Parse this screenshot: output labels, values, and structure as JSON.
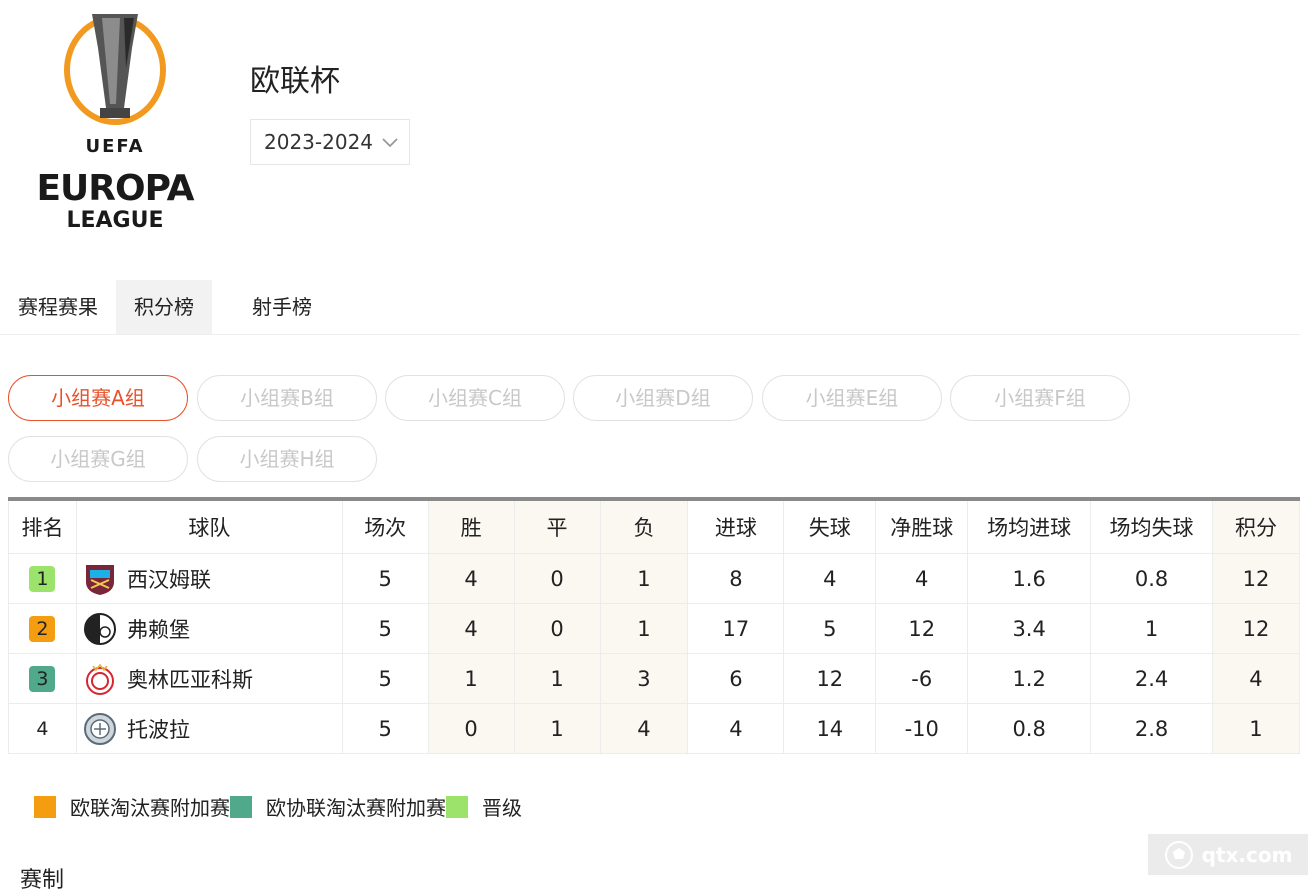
{
  "competition": {
    "title": "欧联杯",
    "season": "2023-2024",
    "logo_text": {
      "uefa": "UEFA",
      "line1": "EUROPA",
      "line2": "LEAGUE"
    }
  },
  "tabs": [
    {
      "label": "赛程赛果",
      "active": false
    },
    {
      "label": "积分榜",
      "active": true
    },
    {
      "label": "射手榜",
      "active": false
    }
  ],
  "groups": [
    {
      "label": "小组赛A组",
      "active": true
    },
    {
      "label": "小组赛B组",
      "active": false
    },
    {
      "label": "小组赛C组",
      "active": false
    },
    {
      "label": "小组赛D组",
      "active": false
    },
    {
      "label": "小组赛E组",
      "active": false
    },
    {
      "label": "小组赛F组",
      "active": false
    },
    {
      "label": "小组赛G组",
      "active": false
    },
    {
      "label": "小组赛H组",
      "active": false
    }
  ],
  "table": {
    "headers": [
      "排名",
      "球队",
      "场次",
      "胜",
      "平",
      "负",
      "进球",
      "失球",
      "净胜球",
      "场均进球",
      "场均失球",
      "积分"
    ],
    "rows": [
      {
        "rank": "1",
        "badge_color": "#9be36a",
        "team": "西汉姆联",
        "crest": "west-ham-crest",
        "played": "5",
        "won": "4",
        "draw": "0",
        "lost": "1",
        "gf": "8",
        "ga": "4",
        "gd": "4",
        "avg_gf": "1.6",
        "avg_ga": "0.8",
        "points": "12"
      },
      {
        "rank": "2",
        "badge_color": "#f59d10",
        "team": "弗赖堡",
        "crest": "freiburg-crest",
        "played": "5",
        "won": "4",
        "draw": "0",
        "lost": "1",
        "gf": "17",
        "ga": "5",
        "gd": "12",
        "avg_gf": "3.4",
        "avg_ga": "1",
        "points": "12"
      },
      {
        "rank": "3",
        "badge_color": "#4fa98a",
        "team": "奥林匹亚科斯",
        "crest": "olympiacos-crest",
        "played": "5",
        "won": "1",
        "draw": "1",
        "lost": "3",
        "gf": "6",
        "ga": "12",
        "gd": "-6",
        "avg_gf": "1.2",
        "avg_ga": "2.4",
        "points": "4"
      },
      {
        "rank": "4",
        "badge_color": "",
        "team": "托波拉",
        "crest": "backa-topola-crest",
        "played": "5",
        "won": "0",
        "draw": "1",
        "lost": "4",
        "gf": "4",
        "ga": "14",
        "gd": "-10",
        "avg_gf": "0.8",
        "avg_ga": "2.8",
        "points": "1"
      }
    ]
  },
  "legend": [
    {
      "color": "#f59d10",
      "label": "欧联淘汰赛附加赛"
    },
    {
      "color": "#4fa98a",
      "label": "欧协联淘汰赛附加赛"
    },
    {
      "color": "#9be36a",
      "label": "晋级"
    }
  ],
  "section_title": "赛制",
  "watermark": "qtx.com"
}
